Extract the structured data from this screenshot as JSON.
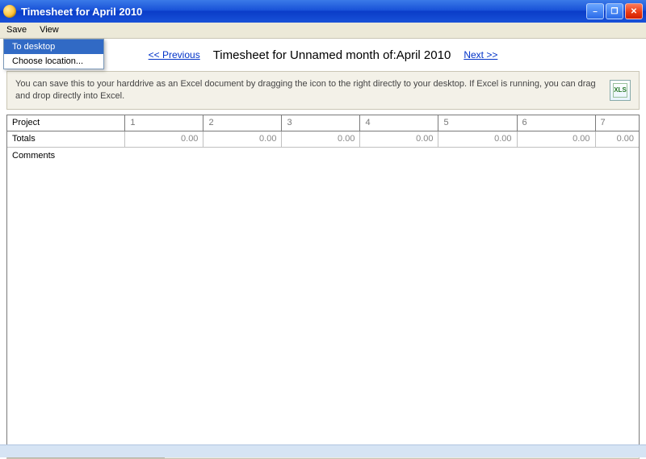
{
  "window": {
    "title": "Timesheet for April 2010"
  },
  "menubar": {
    "save": "Save",
    "view": "View"
  },
  "save_menu": {
    "to_desktop": "To desktop",
    "choose_location": "Choose location..."
  },
  "nav": {
    "previous": "<< Previous",
    "title": "Timesheet for Unnamed month of:April 2010",
    "next": "Next >>"
  },
  "info": {
    "text": "You can save this to your harddrive as an Excel document by dragging the icon to the right directly to your desktop. If Excel is running, you can drag and drop directly into Excel.",
    "icon_label": "XLS"
  },
  "grid": {
    "project_header": "Project",
    "columns": [
      "1",
      "2",
      "3",
      "4",
      "5",
      "6",
      "7"
    ],
    "totals_label": "Totals",
    "totals": [
      "0.00",
      "0.00",
      "0.00",
      "0.00",
      "0.00",
      "0.00",
      "0.00"
    ],
    "comments_label": "Comments"
  }
}
